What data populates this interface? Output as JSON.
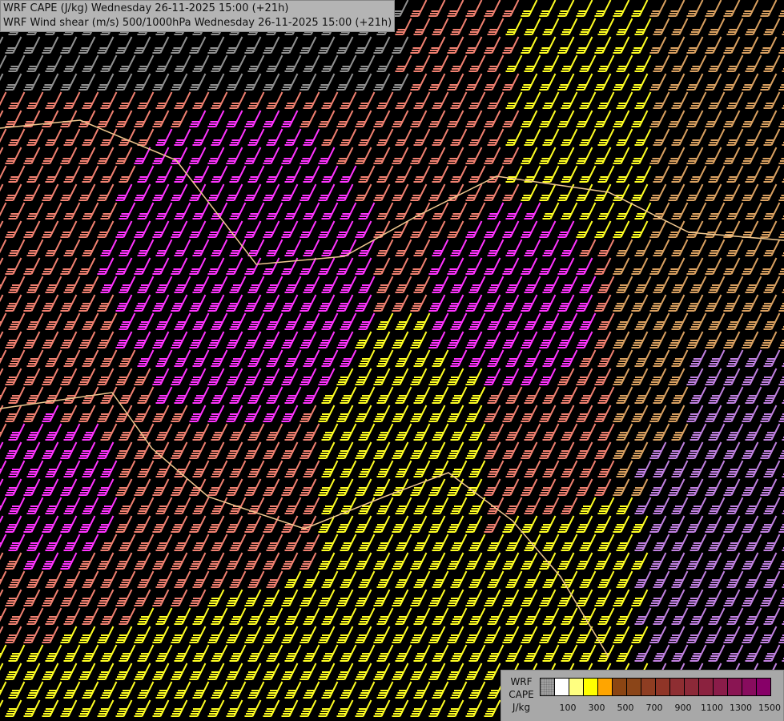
{
  "title": {
    "line1": "WRF CAPE (J/kg) Wednesday 26-11-2025 15:00 (+21h)",
    "line2": "WRF Wind shear (m/s) 500/1000hPa Wednesday 26-11-2025 15:00 (+21h)"
  },
  "legend": {
    "label_lines": [
      "WRF",
      "CAPE",
      "J/kg"
    ],
    "colors": [
      "#a0a0a0",
      "#ffffff",
      "#ffff80",
      "#ffff00",
      "#ffa500",
      "#8b4513",
      "#8b4518",
      "#8e3d22",
      "#8f3527",
      "#8e2e32",
      "#8c2938",
      "#8b223f",
      "#8a1c49",
      "#8a1553",
      "#880c5e",
      "#870068"
    ],
    "ticks": [
      "100",
      "300",
      "500",
      "700",
      "900",
      "1100",
      "1300",
      "1500"
    ]
  },
  "barb_colors": {
    "magenta": "#ff33ff",
    "salmon": "#f08070",
    "yellow": "#ffff22",
    "tan": "#d9a060",
    "lavender": "#c080e0",
    "gray": "#909090"
  }
}
